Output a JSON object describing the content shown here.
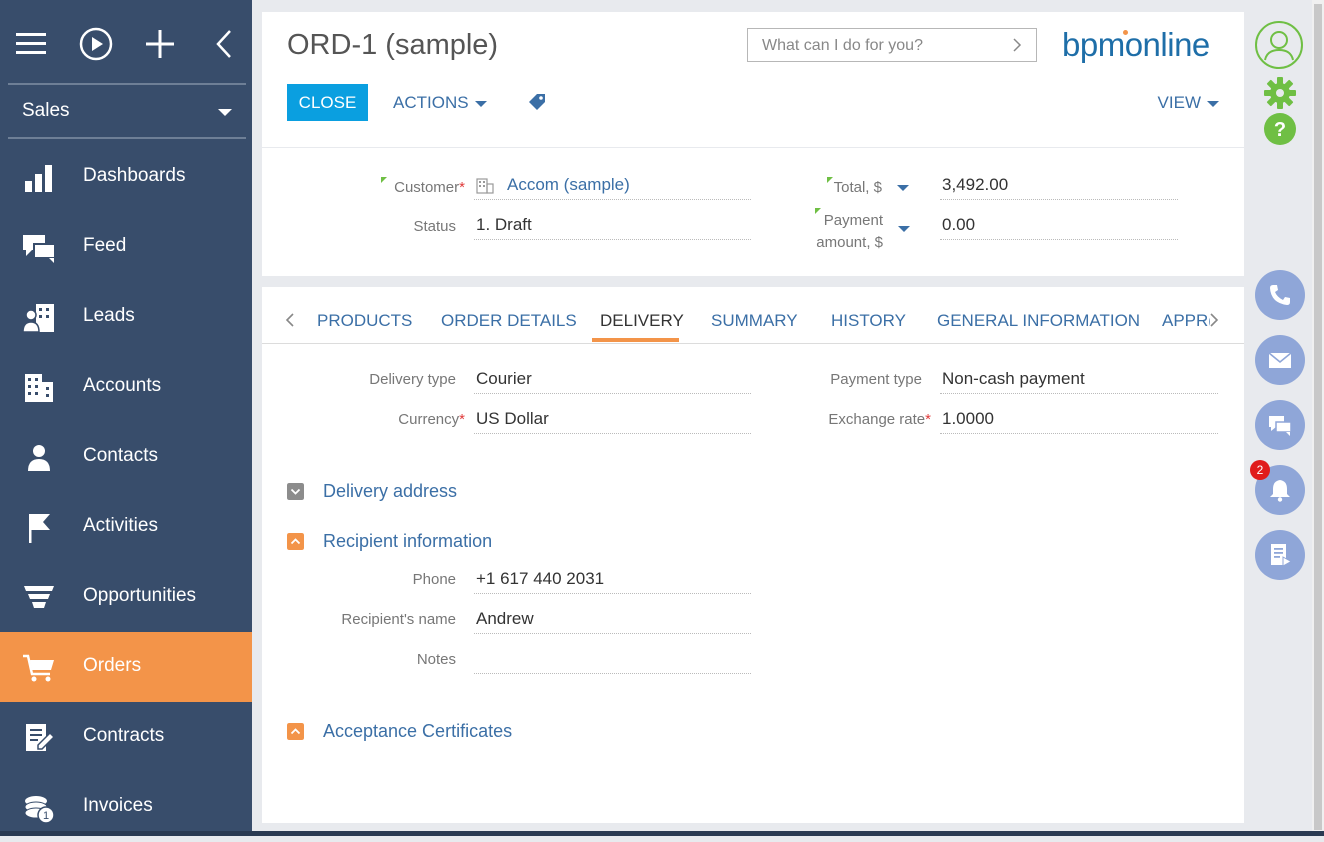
{
  "workspace": {
    "label": "Sales"
  },
  "nav": [
    {
      "label": "Dashboards",
      "icon": "dashboards-icon"
    },
    {
      "label": "Feed",
      "icon": "feed-icon"
    },
    {
      "label": "Leads",
      "icon": "leads-icon"
    },
    {
      "label": "Accounts",
      "icon": "accounts-icon"
    },
    {
      "label": "Contacts",
      "icon": "contacts-icon"
    },
    {
      "label": "Activities",
      "icon": "activities-icon"
    },
    {
      "label": "Opportunities",
      "icon": "opportunities-icon"
    },
    {
      "label": "Orders",
      "icon": "orders-icon",
      "active": true
    },
    {
      "label": "Contracts",
      "icon": "contracts-icon"
    },
    {
      "label": "Invoices",
      "icon": "invoices-icon"
    }
  ],
  "header": {
    "title": "ORD-1 (sample)",
    "search_placeholder": "What can I do for you?",
    "logo": {
      "part1": "bpm",
      "part2": "online"
    },
    "close_label": "CLOSE",
    "actions_label": "ACTIONS",
    "view_label": "VIEW"
  },
  "info": {
    "customer_label": "Customer",
    "customer_value": "Accom (sample)",
    "status_label": "Status",
    "status_value": "1. Draft",
    "total_label": "Total, $",
    "total_value": "3,492.00",
    "payment_label_1": "Payment",
    "payment_label_2": "amount, $",
    "payment_value": "0.00"
  },
  "tabs": [
    {
      "label": "PRODUCTS"
    },
    {
      "label": "ORDER DETAILS"
    },
    {
      "label": "DELIVERY",
      "active": true
    },
    {
      "label": "SUMMARY"
    },
    {
      "label": "HISTORY"
    },
    {
      "label": "GENERAL INFORMATION"
    },
    {
      "label": "APPR("
    }
  ],
  "delivery": {
    "delivery_type_label": "Delivery type",
    "delivery_type_value": "Courier",
    "currency_label": "Currency",
    "currency_value": "US Dollar",
    "payment_type_label": "Payment type",
    "payment_type_value": "Non-cash payment",
    "exchange_rate_label": "Exchange rate",
    "exchange_rate_value": "1.0000"
  },
  "groups": {
    "delivery_address": "Delivery address",
    "recipient_information": "Recipient information",
    "acceptance_certificates": "Acceptance Certificates"
  },
  "recipient": {
    "phone_label": "Phone",
    "phone_value": "+1 617 440 2031",
    "name_label": "Recipient's name",
    "name_value": "Andrew",
    "notes_label": "Notes",
    "notes_value": ""
  },
  "rail": {
    "notification_count": "2"
  },
  "colors": {
    "sidebar": "#384d6b",
    "accent_orange": "#f39449",
    "primary_blue": "#0a9fe0",
    "link_blue": "#3b6fa6",
    "rail_button": "#8fa6d8",
    "settings_green": "#6fbf44"
  }
}
